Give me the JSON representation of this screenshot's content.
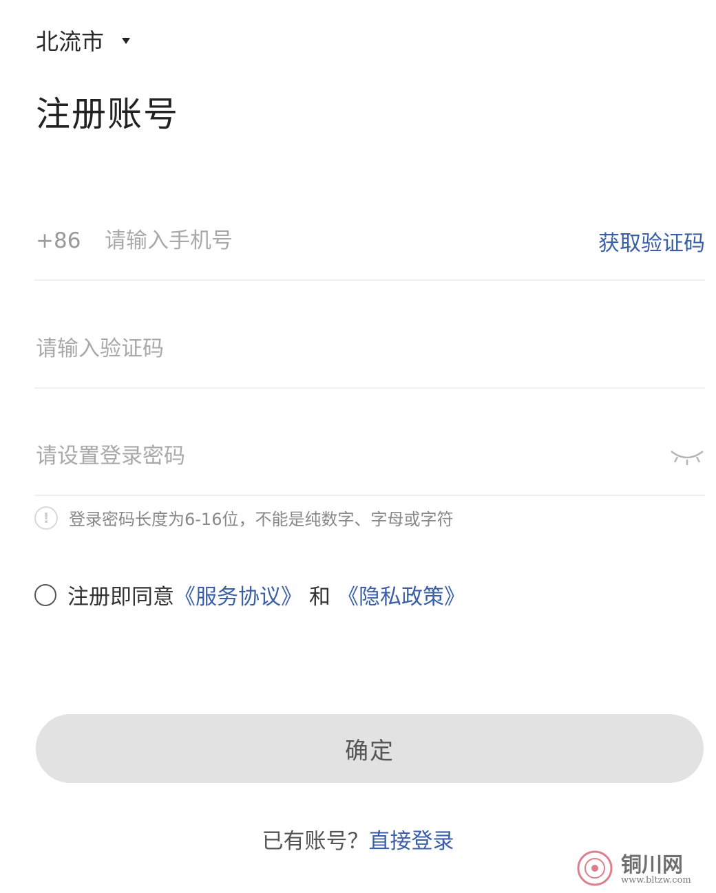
{
  "header": {
    "city": "北流市",
    "title": "注册账号"
  },
  "phone": {
    "prefix": "+86",
    "placeholder": "请输入手机号",
    "get_code_label": "获取验证码"
  },
  "code": {
    "placeholder": "请输入验证码"
  },
  "password": {
    "placeholder": "请设置登录密码",
    "toggle_icon": "eye-closed-icon",
    "hint_icon": "info-icon",
    "hint": "登录密码长度为6-16位，不能是纯数字、字母或字符"
  },
  "agreement": {
    "prefix": "注册即同意",
    "service_link": "《服务协议》",
    "and": "和",
    "privacy_link": "《隐私政策》"
  },
  "confirm_label": "确定",
  "login": {
    "question": "已有账号？",
    "link": "直接登录"
  },
  "watermark": {
    "text": "铜川网",
    "url": "www.bltzw.com"
  },
  "colors": {
    "link": "#3a5fa8",
    "button_bg": "#e2e2e2",
    "placeholder": "#a9a9a9",
    "divider": "#efefef"
  }
}
